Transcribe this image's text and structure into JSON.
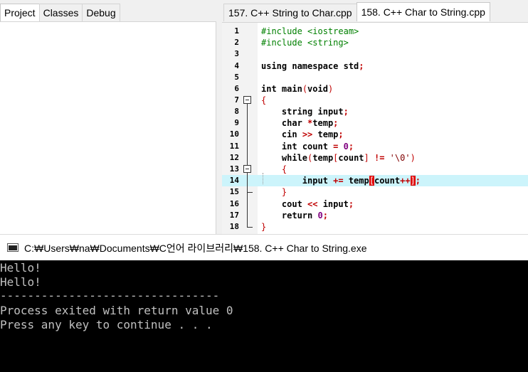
{
  "left_tabs": [
    "Project",
    "Classes",
    "Debug"
  ],
  "editor_tabs": [
    "157. C++ String to Char.cpp",
    "158. C++ Char to String.cpp"
  ],
  "code": {
    "line_numbers": [
      "1",
      "2",
      "3",
      "4",
      "5",
      "6",
      "7",
      "8",
      "9",
      "10",
      "11",
      "12",
      "13",
      "14",
      "15",
      "16",
      "17",
      "18"
    ],
    "tokens": {
      "inc1": "#include <iostream>",
      "inc2": "#include <string>",
      "using": "using namespace std",
      "semi": ";",
      "int": "int",
      "main": " main",
      "lp": "(",
      "void": "void",
      "rp": ")",
      "lbrace": "{",
      "rbrace": "}",
      "string": "string",
      "input": " input",
      "char": "char",
      "star": " *",
      "temp": "temp",
      "cin": "cin ",
      "shr": ">>",
      "temp_sp": " temp",
      "count": " count ",
      "eq": "=",
      "zero": " 0",
      "while": "while",
      "temp_idx": "temp",
      "lb": "[",
      "count_w": "count",
      "rb": "]",
      "neq": " != ",
      "nullch": "'\\0'",
      "input_op": "input ",
      "pluseq": "+=",
      "temp_b": " temp",
      "inc": "++",
      "cout": "cout ",
      "shl": "<<",
      "input2": " input",
      "return": "return",
      "zero2": " 0"
    }
  },
  "console": {
    "title": "C:₩Users₩na₩Documents₩C언어 라이브러리₩158. C++ Char to String.exe",
    "lines": [
      "Hello!",
      "Hello!",
      "--------------------------------",
      "Process exited with return value 0",
      "Press any key to continue . . ."
    ]
  },
  "colors": {
    "preprocessor": "#008000",
    "operator": "#c00000",
    "number": "#800080",
    "highlight_line": "#ccf4fb",
    "bracket_match": "#e00000"
  }
}
